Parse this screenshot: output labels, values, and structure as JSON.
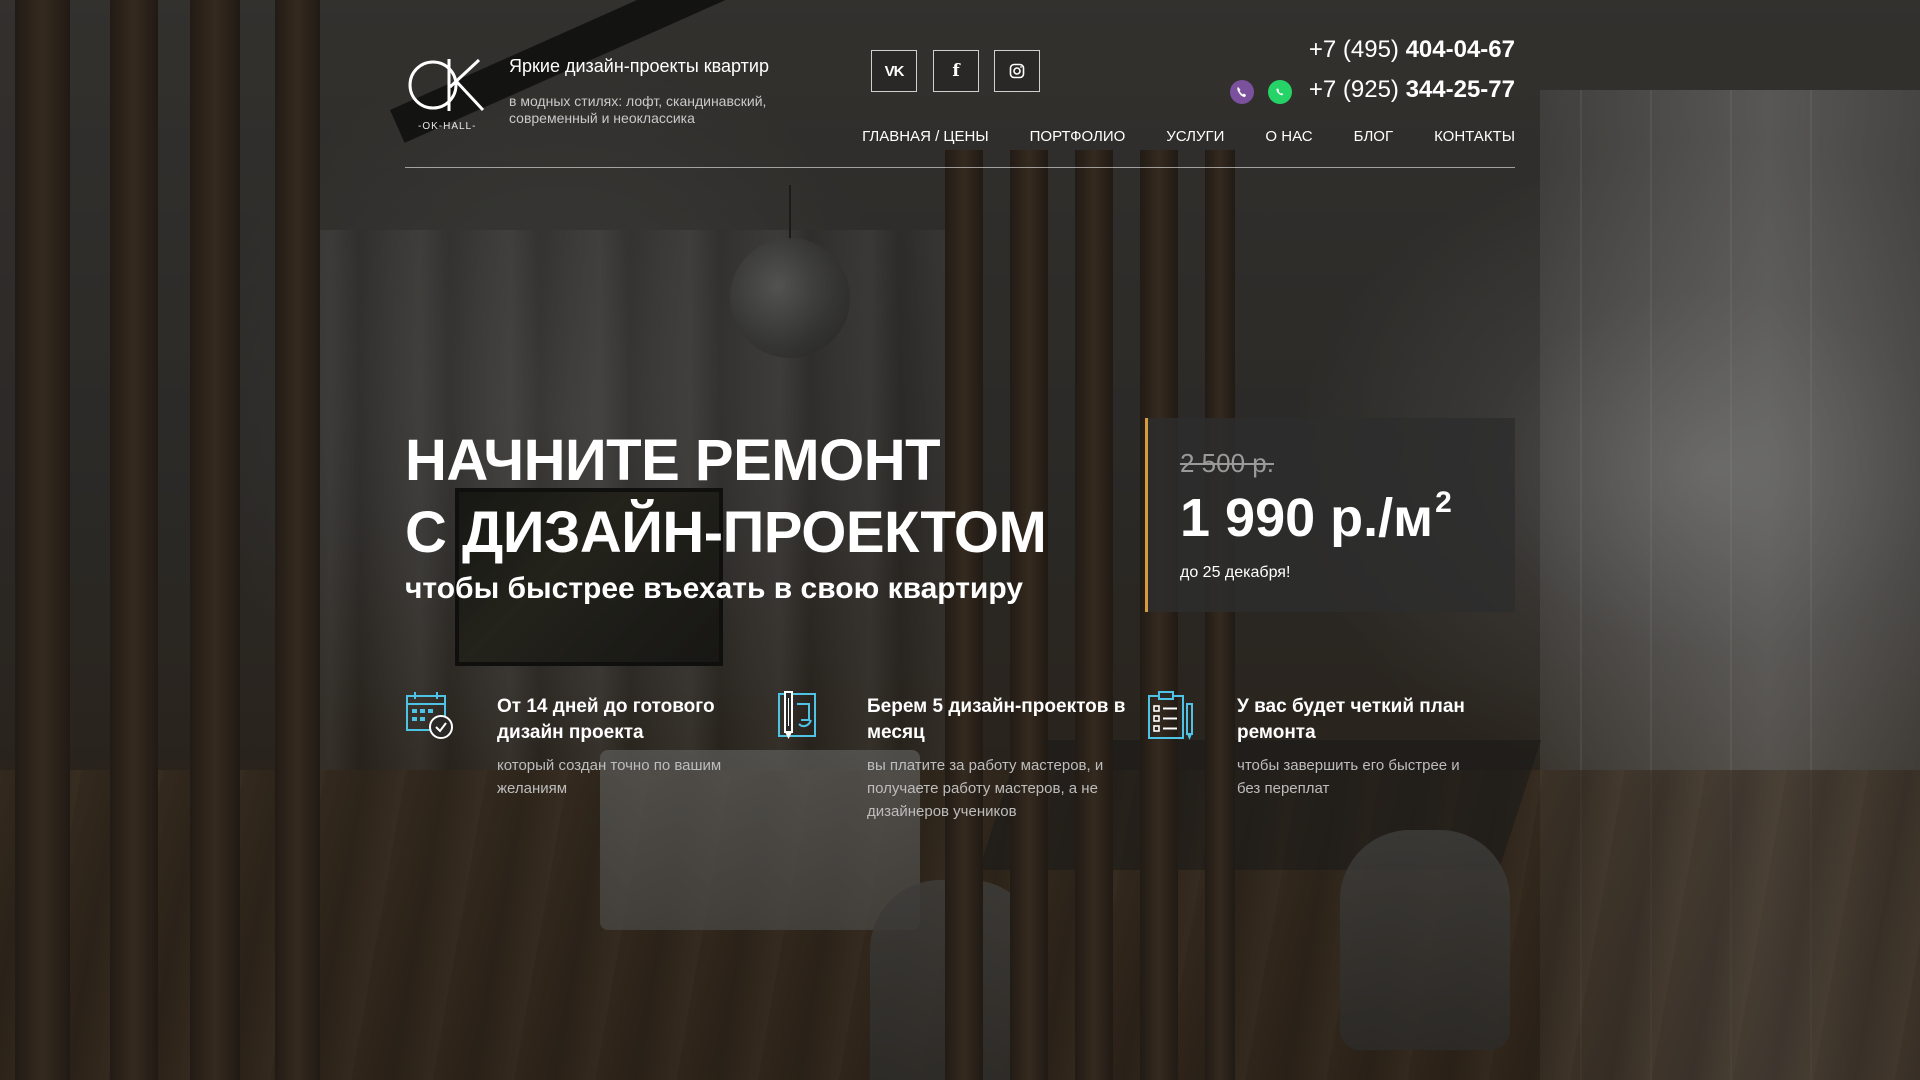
{
  "brand": {
    "logo_text": "OK",
    "logo_caption": "-OK-HALL-",
    "tagline_title": "Яркие дизайн-проекты квартир",
    "tagline_sub": "в модных стилях: лофт, скандинавский, современный и неоклассика"
  },
  "social": [
    {
      "icon": "vk-icon",
      "label": "VK"
    },
    {
      "icon": "facebook-icon",
      "label": "f"
    },
    {
      "icon": "instagram-icon",
      "label": "◎"
    }
  ],
  "contacts": {
    "phone1_prefix": "+7 (495)",
    "phone1_number": "404-04-67",
    "phone2_prefix": "+7 (925)",
    "phone2_number": "344-25-77",
    "messengers": [
      "viber-icon",
      "whatsapp-icon"
    ]
  },
  "nav": {
    "items": [
      {
        "label": "ГЛАВНАЯ / ЦЕНЫ"
      },
      {
        "label": "ПОРТФОЛИО"
      },
      {
        "label": "УСЛУГИ"
      },
      {
        "label": "О НАС"
      },
      {
        "label": "БЛОГ"
      },
      {
        "label": "КОНТАКТЫ"
      }
    ]
  },
  "hero": {
    "line1": "НАЧНИТЕ РЕМОНТ",
    "line2": "С ДИЗАЙН-ПРОЕКТОМ",
    "subtitle": "чтобы быстрее въехать в свою квартиру"
  },
  "price": {
    "old": "2 500 р.",
    "new": "1 990 р./м",
    "unit_power": "2",
    "note": "до 25 декабря!"
  },
  "features": [
    {
      "icon": "calendar-check-icon",
      "title": "От 14 дней до готового дизайн проекта",
      "text": "который создан точно по вашим желаниям"
    },
    {
      "icon": "blueprint-pencil-icon",
      "title": "Берем 5 дизайн-проектов в месяц",
      "text": "вы платите за работу мастеров, и получаете работу мастеров, а не дизайнеров учеников"
    },
    {
      "icon": "checklist-icon",
      "title": "У вас будет четкий план ремонта",
      "text": "чтобы завершить его быстрее и без переплат"
    }
  ],
  "colors": {
    "accent_gold": "#d69b3e",
    "icon_teal": "#4fc3e6",
    "viber": "#7b519d",
    "whatsapp": "#25d366"
  }
}
